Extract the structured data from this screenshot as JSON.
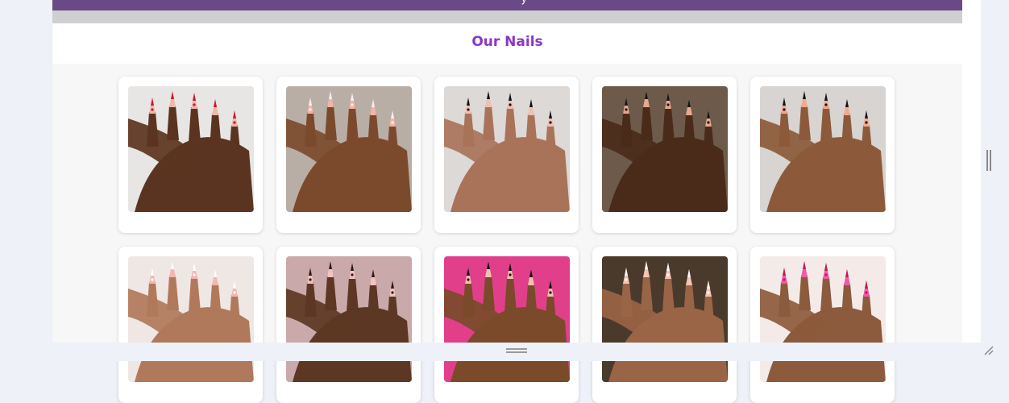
{
  "header": {
    "banner_text": "y"
  },
  "gallery": {
    "title": "Our Nails",
    "title_color": "#8b35c9",
    "items": [
      {
        "skin": "#5a3420",
        "bg": "#e8e6e4",
        "nail": "#f2b7a8",
        "accent": "#c8182c"
      },
      {
        "skin": "#7b4a2c",
        "bg": "#b9aea5",
        "nail": "#f3b4a6",
        "accent": "#f6f0ef"
      },
      {
        "skin": "#a9735a",
        "bg": "#ddd9d7",
        "nail": "#f0c0b4",
        "accent": "#111111"
      },
      {
        "skin": "#4a2b19",
        "bg": "#6d5a4a",
        "nail": "#e8a890",
        "accent": "#151515"
      },
      {
        "skin": "#8c5a3a",
        "bg": "#d7d4d2",
        "nail": "#f2a98e",
        "accent": "#141414"
      },
      {
        "skin": "#b0795b",
        "bg": "#efe7e4",
        "nail": "#f4b7b0",
        "accent": "#ffffff"
      },
      {
        "skin": "#5c3723",
        "bg": "#c9a9aa",
        "nail": "#f4c3c0",
        "accent": "#2a1a12"
      },
      {
        "skin": "#7a4a2b",
        "bg": "#e13f8a",
        "nail": "#f2c0ac",
        "accent": "#111111"
      },
      {
        "skin": "#9a6446",
        "bg": "#4a3a2c",
        "nail": "#f5c2b4",
        "accent": "#fafafa"
      },
      {
        "skin": "#8c5a3c",
        "bg": "#f4ebe8",
        "nail": "#f15aa8",
        "accent": "#c0185a"
      }
    ]
  }
}
